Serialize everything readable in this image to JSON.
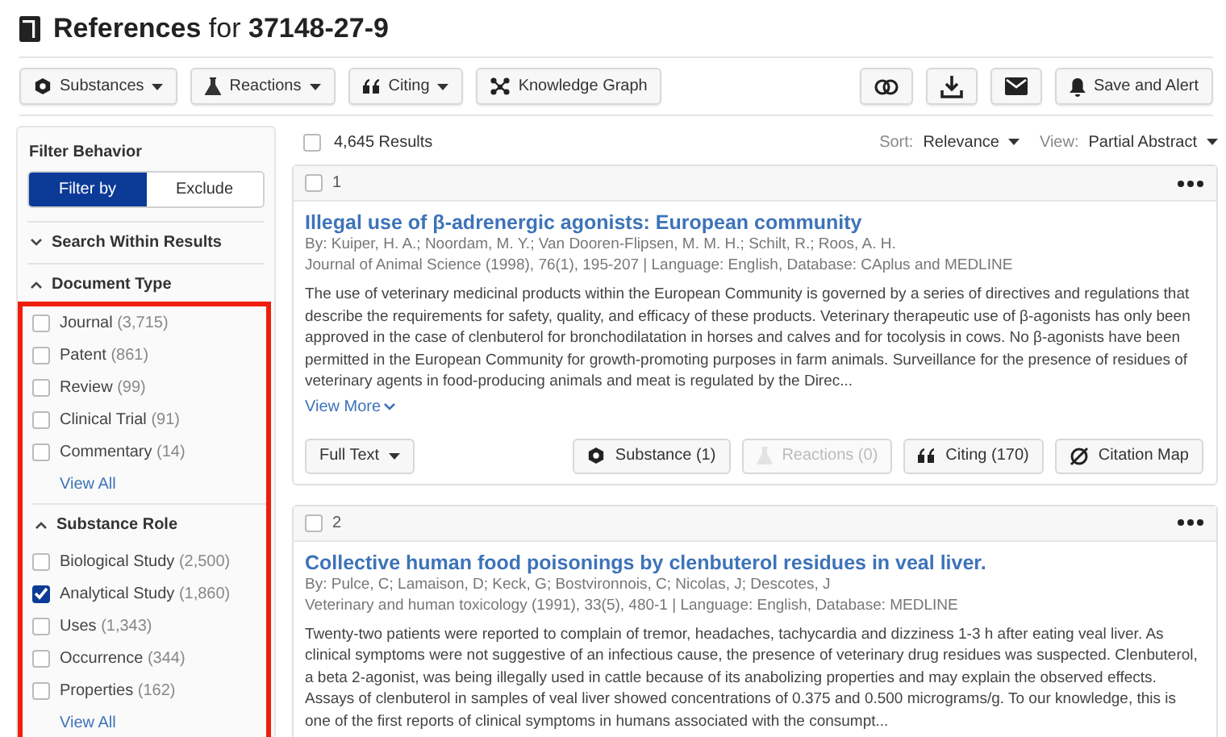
{
  "header": {
    "title": "References",
    "for_label": "for",
    "query": "37148-27-9"
  },
  "toolbar": {
    "left": [
      {
        "kind": "substance",
        "label": "Substances",
        "dropdown": true
      },
      {
        "kind": "reaction",
        "label": "Reactions",
        "dropdown": true
      },
      {
        "kind": "citing",
        "label": "Citing",
        "dropdown": true
      },
      {
        "kind": "graph",
        "label": "Knowledge Graph",
        "dropdown": false
      }
    ],
    "right": [
      {
        "kind": "venn"
      },
      {
        "kind": "download"
      },
      {
        "kind": "email"
      },
      {
        "kind": "bell",
        "label": "Save and Alert"
      }
    ]
  },
  "sidebar": {
    "title": "Filter Behavior",
    "toggle": [
      {
        "label": "Filter by",
        "selected": true
      },
      {
        "label": "Exclude",
        "selected": false
      }
    ],
    "sections": [
      {
        "label": "Search Within Results",
        "expanded": false
      },
      {
        "label": "Document Type",
        "expanded": true,
        "items": [
          {
            "label": "Journal",
            "count": "(3,715)",
            "checked": false
          },
          {
            "label": "Patent",
            "count": "(861)",
            "checked": false
          },
          {
            "label": "Review",
            "count": "(99)",
            "checked": false
          },
          {
            "label": "Clinical Trial",
            "count": "(91)",
            "checked": false
          },
          {
            "label": "Commentary",
            "count": "(14)",
            "checked": false
          }
        ],
        "view_all": "View All"
      },
      {
        "label": "Substance Role",
        "expanded": true,
        "items": [
          {
            "label": "Biological Study",
            "count": "(2,500)",
            "checked": false
          },
          {
            "label": "Analytical Study",
            "count": "(1,860)",
            "checked": true
          },
          {
            "label": "Uses",
            "count": "(1,343)",
            "checked": false
          },
          {
            "label": "Occurrence",
            "count": "(344)",
            "checked": false
          },
          {
            "label": "Properties",
            "count": "(162)",
            "checked": false
          }
        ],
        "view_all": "View All"
      }
    ]
  },
  "results_bar": {
    "checked": false,
    "count": "4,645 Results",
    "sort_label": "Sort:",
    "sort_value": "Relevance",
    "view_label": "View:",
    "view_value": "Partial Abstract"
  },
  "results": [
    {
      "number": "1",
      "checked": false,
      "title": "Illegal use of β-adrenergic agonists: European community",
      "authors": "By: Kuiper, H. A.; Noordam, M. Y.; Van Dooren-Flipsen, M. M. H.; Schilt, R.; Roos, A. H.",
      "source": "Journal of Animal Science (1998), 76(1), 195-207 | Language: English, Database: CAplus and MEDLINE",
      "abstract": "The use of veterinary medicinal products within the European Community is governed by a series of directives and regulations that describe the requirements for safety, quality, and efficacy of these products. Veterinary therapeutic use of β-agonists has only been approved in the case of clenbuterol for bronchodilatation in horses and calves and for tocolysis in cows. No β-agonists have been permitted in the European Community for growth-promoting purposes in farm animals. Surveillance for the presence of residues of veterinary agents in food-producing animals and meat is regulated by the Direc...",
      "view_more": "View More",
      "full_text": "Full Text",
      "actions": [
        {
          "kind": "substance",
          "label": "Substance (1)",
          "disabled": false
        },
        {
          "kind": "reaction",
          "label": "Reactions (0)",
          "disabled": true
        },
        {
          "kind": "citing",
          "label": "Citing (170)",
          "disabled": false
        },
        {
          "kind": "citation-map",
          "label": "Citation Map",
          "disabled": false
        }
      ]
    },
    {
      "number": "2",
      "checked": false,
      "title": "Collective human food poisonings by clenbuterol residues in veal liver.",
      "authors": "By: Pulce, C; Lamaison, D; Keck, G; Bostvironnois, C; Nicolas, J; Descotes, J",
      "source": "Veterinary and human toxicology (1991), 33(5), 480-1 | Language: English, Database: MEDLINE",
      "abstract": "Twenty-two patients were reported to complain of tremor, headaches, tachycardia and dizziness 1-3 h after eating veal liver. As clinical symptoms were not suggestive of an infectious cause, the presence of veterinary drug residues was suspected. Clenbuterol, a beta 2-agonist, was being illegally used in cattle because of its anabolizing properties and may explain the observed effects. Assays of clenbuterol in samples of veal liver showed concentrations of 0.375 and 0.500 micrograms/g. To our knowledge, this is one of the first reports of clinical symptoms in humans associated with the consumpt..."
    }
  ]
}
